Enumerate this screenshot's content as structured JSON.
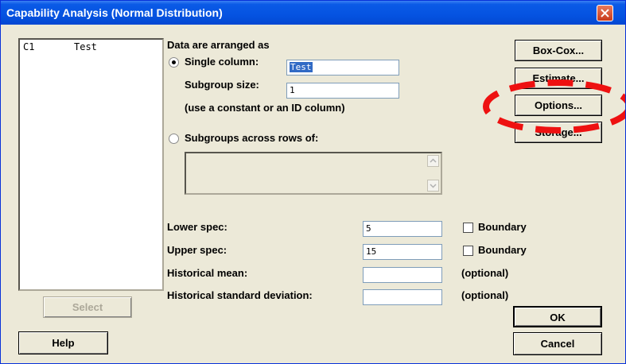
{
  "window": {
    "title": "Capability Analysis (Normal Distribution)"
  },
  "variables_list": {
    "items": [
      {
        "column": "C1",
        "name": "Test"
      }
    ]
  },
  "data_arrangement": {
    "heading": "Data are arranged as",
    "single_column": {
      "label": "Single column:",
      "value": "Test",
      "selected": true
    },
    "subgroup_size": {
      "label": "Subgroup size:",
      "value": "1"
    },
    "hint": "(use a constant or an ID column)",
    "subgroups_across_rows": {
      "label": "Subgroups across rows of:",
      "selected": false
    }
  },
  "specs": {
    "lower": {
      "label": "Lower spec:",
      "value": "5",
      "boundary_label": "Boundary",
      "boundary_checked": false
    },
    "upper": {
      "label": "Upper spec:",
      "value": "15",
      "boundary_label": "Boundary",
      "boundary_checked": false
    },
    "historical_mean": {
      "label": "Historical mean:",
      "value": "",
      "note": "(optional)"
    },
    "historical_sd": {
      "label": "Historical standard deviation:",
      "value": "",
      "note": "(optional)"
    }
  },
  "buttons": {
    "box_cox": "Box-Cox...",
    "estimate": "Estimate...",
    "options": "Options...",
    "storage": "Storage...",
    "select": "Select",
    "help": "Help",
    "ok": "OK",
    "cancel": "Cancel"
  },
  "colors": {
    "titlebar": "#0553e1",
    "dialog_bg": "#ece9d8",
    "annotation_red": "#ee1111",
    "selection": "#316ac5"
  }
}
